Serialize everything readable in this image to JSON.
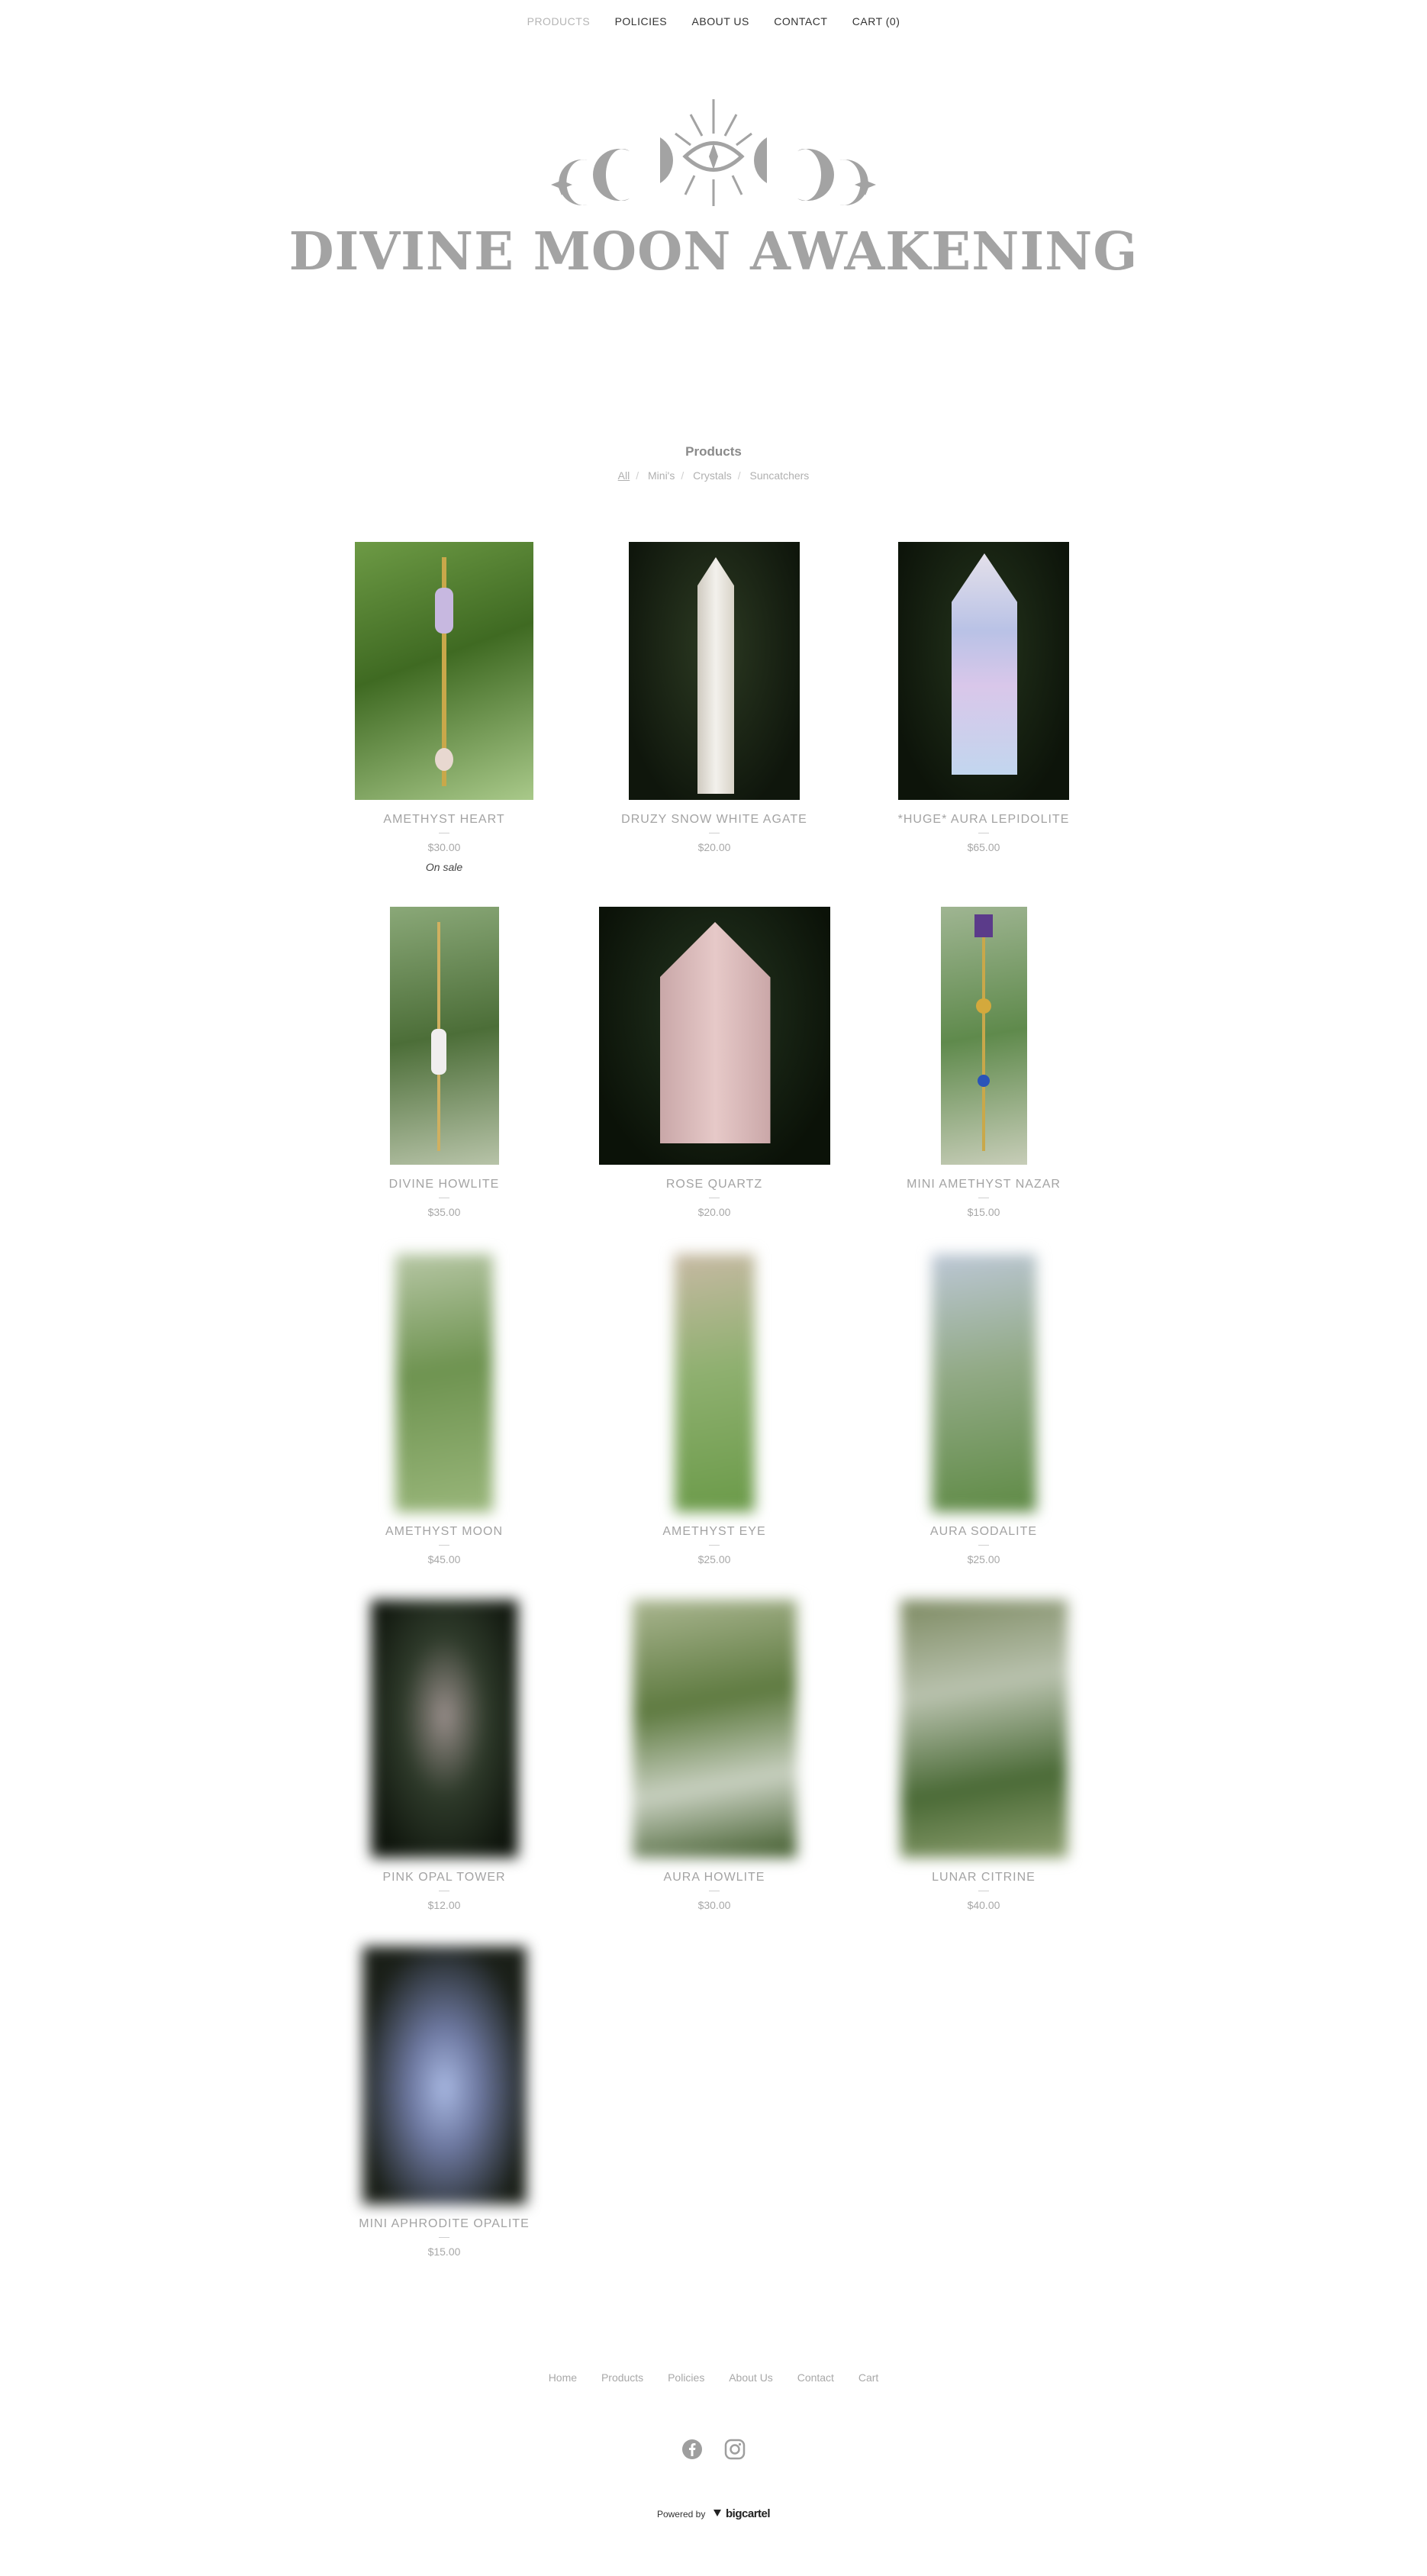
{
  "nav": {
    "items": [
      "PRODUCTS",
      "POLICIES",
      "ABOUT US",
      "CONTACT",
      "CART (0)"
    ]
  },
  "brand": {
    "name": "DIVINE MOON AWAKENING"
  },
  "products_section": {
    "title": "Products",
    "categories": [
      "All",
      "Mini's",
      "Crystals",
      "Suncatchers"
    ]
  },
  "products": [
    {
      "name": "AMETHYST HEART",
      "price": "$30.00",
      "badge": "On sale"
    },
    {
      "name": "DRUZY SNOW WHITE AGATE",
      "price": "$20.00"
    },
    {
      "name": "*HUGE* AURA LEPIDOLITE",
      "price": "$65.00"
    },
    {
      "name": "DIVINE HOWLITE",
      "price": "$35.00"
    },
    {
      "name": "ROSE QUARTZ",
      "price": "$20.00"
    },
    {
      "name": "MINI AMETHYST NAZAR",
      "price": "$15.00"
    },
    {
      "name": "AMETHYST MOON",
      "price": "$45.00"
    },
    {
      "name": "AMETHYST EYE",
      "price": "$25.00"
    },
    {
      "name": "AURA SODALITE",
      "price": "$25.00"
    },
    {
      "name": "PINK OPAL TOWER",
      "price": "$12.00"
    },
    {
      "name": "AURA HOWLITE",
      "price": "$30.00"
    },
    {
      "name": "LUNAR CITRINE",
      "price": "$40.00"
    },
    {
      "name": "MINI APHRODITE OPALITE",
      "price": "$15.00"
    }
  ],
  "footer": {
    "links": [
      "Home",
      "Products",
      "Policies",
      "About Us",
      "Contact",
      "Cart"
    ],
    "social": [
      "facebook-icon",
      "instagram-icon"
    ],
    "powered_by": "Powered by",
    "platform": "bigcartel"
  },
  "colors": {
    "logo": "#a3a3a3",
    "text_muted": "#a8a8a8",
    "nav_text": "#333333"
  }
}
